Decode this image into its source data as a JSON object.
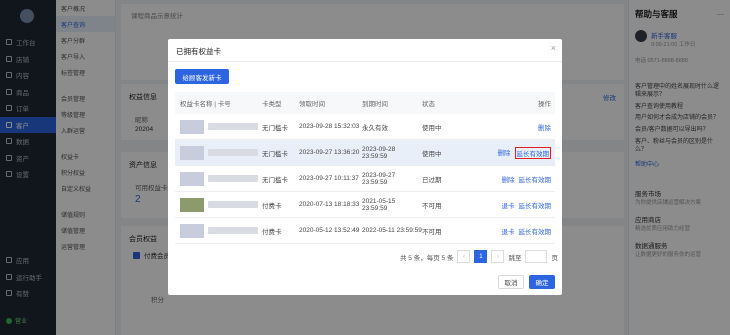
{
  "nav": {
    "items": [
      {
        "label": "工作台",
        "active": false
      },
      {
        "label": "店铺",
        "active": false
      },
      {
        "label": "内容",
        "active": false
      },
      {
        "label": "商品",
        "active": false
      },
      {
        "label": "订单",
        "active": false
      },
      {
        "label": "客户",
        "active": true
      },
      {
        "label": "数据",
        "active": false
      },
      {
        "label": "资产",
        "active": false
      },
      {
        "label": "设置",
        "active": false
      }
    ],
    "bottom": [
      {
        "label": "应用"
      },
      {
        "label": "运行助手"
      },
      {
        "label": "有赞"
      }
    ],
    "status": "营业"
  },
  "subnav": {
    "items": [
      {
        "label": "客户概况",
        "active": false
      },
      {
        "label": "客户查询",
        "active": true
      },
      {
        "label": "客户分群",
        "active": false
      },
      {
        "label": "客户导入",
        "active": false
      },
      {
        "label": "标签管理",
        "active": false
      },
      {
        "label": "会员管理",
        "active": false
      },
      {
        "label": "等级管理",
        "active": false
      },
      {
        "label": "入群运营",
        "active": false
      },
      {
        "label": "权益卡",
        "active": false
      },
      {
        "label": "积分权益",
        "active": false
      },
      {
        "label": "自定义权益",
        "active": false
      },
      {
        "label": "储值规则",
        "active": false
      },
      {
        "label": "储值管理",
        "active": false
      },
      {
        "label": "运营管理",
        "active": false
      }
    ]
  },
  "background": {
    "top_label": "课程商品示意统计",
    "section1": "权益信息",
    "section1_link": "修改",
    "col_a": "昵称",
    "val_a": "20204",
    "section2": "资产信息",
    "asset_label": "可用权益卡数量",
    "asset_value": "2",
    "section3": "会员权益",
    "checkbox_label": "付费会员卡",
    "table_label": "积分"
  },
  "help": {
    "title": "帮助与客服",
    "agent": "新手客服",
    "hours": "9:00-21:00 工作日",
    "phone": "电话 0571-8888-8888",
    "faq": [
      "客户管理中的姓名展现时什么逻辑来展示？",
      "客户查询使用教程",
      "用户如何才会成为店铺的会员？",
      "会员/客户数据可以导出吗？",
      "客户、粉丝与会员的区别是什么？"
    ],
    "more": "帮助中心",
    "service_title": "服务市场",
    "service_desc": "为你提供店铺运营解决方案",
    "app_title": "应用商店",
    "app_desc": "精选优质应用助力经营",
    "data_title": "数据通服务",
    "data_desc": "让数据更好的服务你的运营"
  },
  "modal": {
    "title": "已拥有权益卡",
    "close_icon": "close-icon",
    "issue_button": "给顾客发新卡",
    "headers": [
      "权益卡名称 | 卡号",
      "卡类型",
      "领取时间",
      "到期时间",
      "状态",
      "操作"
    ],
    "rows": [
      {
        "type": "无门槛卡",
        "received": "2023-09-28 15:32:03",
        "expires": "永久有效",
        "status": "使用中",
        "actions": [
          "删除"
        ],
        "highlight": false,
        "boxed": false
      },
      {
        "type": "无门槛卡",
        "received": "2023-09-27 13:36:20",
        "expires": "2023-09-28 23:59:59",
        "status": "使用中",
        "actions": [
          "删除",
          "延长有效期"
        ],
        "highlight": true,
        "boxed": true
      },
      {
        "type": "无门槛卡",
        "received": "2023-09-27 10:11:37",
        "expires": "2023-09-27 23:59:59",
        "status": "已过期",
        "actions": [
          "删除",
          "延长有效期"
        ],
        "highlight": false,
        "boxed": false
      },
      {
        "type": "付费卡",
        "received": "2020-07-13 18:18:33",
        "expires": "2021-05-15 23:59:59",
        "status": "不可用",
        "actions": [
          "退卡",
          "延长有效期"
        ],
        "highlight": false,
        "boxed": false
      },
      {
        "type": "付费卡",
        "received": "2020-05-12 13:52:49",
        "expires": "2022-05-11 23:59:59",
        "status": "不可用",
        "actions": [
          "退卡",
          "延长有效期"
        ],
        "highlight": false,
        "boxed": false
      }
    ],
    "pagination": {
      "summary": "共 5 条，每页 5 条",
      "current_page": "1",
      "jump_label": "跳至",
      "page_unit": "页"
    },
    "cancel": "取消",
    "confirm": "确定"
  }
}
